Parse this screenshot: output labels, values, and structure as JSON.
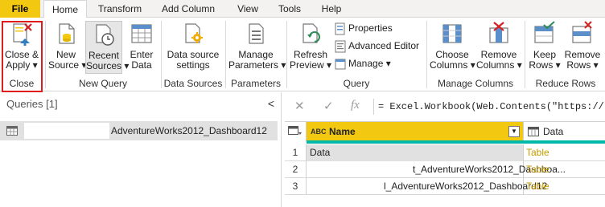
{
  "menu": {
    "tabs": [
      "File",
      "Home",
      "Transform",
      "Add Column",
      "View",
      "Tools",
      "Help"
    ]
  },
  "ribbon": {
    "close": {
      "btn1": "Close &",
      "btn2": "Apply",
      "group": "Close"
    },
    "new_query": {
      "new_source_1": "New",
      "new_source_2": "Source",
      "recent_sources_1": "Recent",
      "recent_sources_2": "Sources",
      "enter_data_1": "Enter",
      "enter_data_2": "Data",
      "group": "New Query"
    },
    "data_sources": {
      "btn1": "Data source",
      "btn2": "settings",
      "group": "Data Sources"
    },
    "parameters": {
      "btn1": "Manage",
      "btn2": "Parameters",
      "group": "Parameters"
    },
    "query": {
      "refresh_1": "Refresh",
      "refresh_2": "Preview",
      "properties": "Properties",
      "advanced_editor": "Advanced Editor",
      "manage": "Manage",
      "group": "Query"
    },
    "manage_columns": {
      "choose_1": "Choose",
      "choose_2": "Columns",
      "remove_1": "Remove",
      "remove_2": "Columns",
      "group": "Manage Columns"
    },
    "reduce_rows": {
      "keep_1": "Keep",
      "keep_2": "Rows",
      "remove_1": "Remove",
      "remove_2": "Rows",
      "group": "Reduce Rows"
    },
    "accent_highlight": "#e01b1b"
  },
  "queries": {
    "header": "Queries [1]",
    "collapse_glyph": "<",
    "items": [
      {
        "name": "AdventureWorks2012_Dashboard12"
      }
    ]
  },
  "formula_bar": {
    "cancel_glyph": "✕",
    "commit_glyph": "✓",
    "fx_glyph": "fx",
    "formula": "= Excel.Workbook(Web.Contents(\"https://     a"
  },
  "grid": {
    "columns": [
      {
        "label": "Name",
        "type_badge": "ABC"
      },
      {
        "label": "Data"
      }
    ],
    "rows": [
      {
        "num": "1",
        "name": "Data",
        "data": "Table"
      },
      {
        "num": "2",
        "name": "t_AdventureWorks2012_Dashboa...",
        "data": "Table"
      },
      {
        "num": "3",
        "name": "l_AdventureWorks2012_Dashboard12",
        "data": "Table"
      }
    ],
    "header_color": "#f2c811",
    "quality_bar_color": "#01b8aa",
    "table_link_color": "#c49a00"
  }
}
